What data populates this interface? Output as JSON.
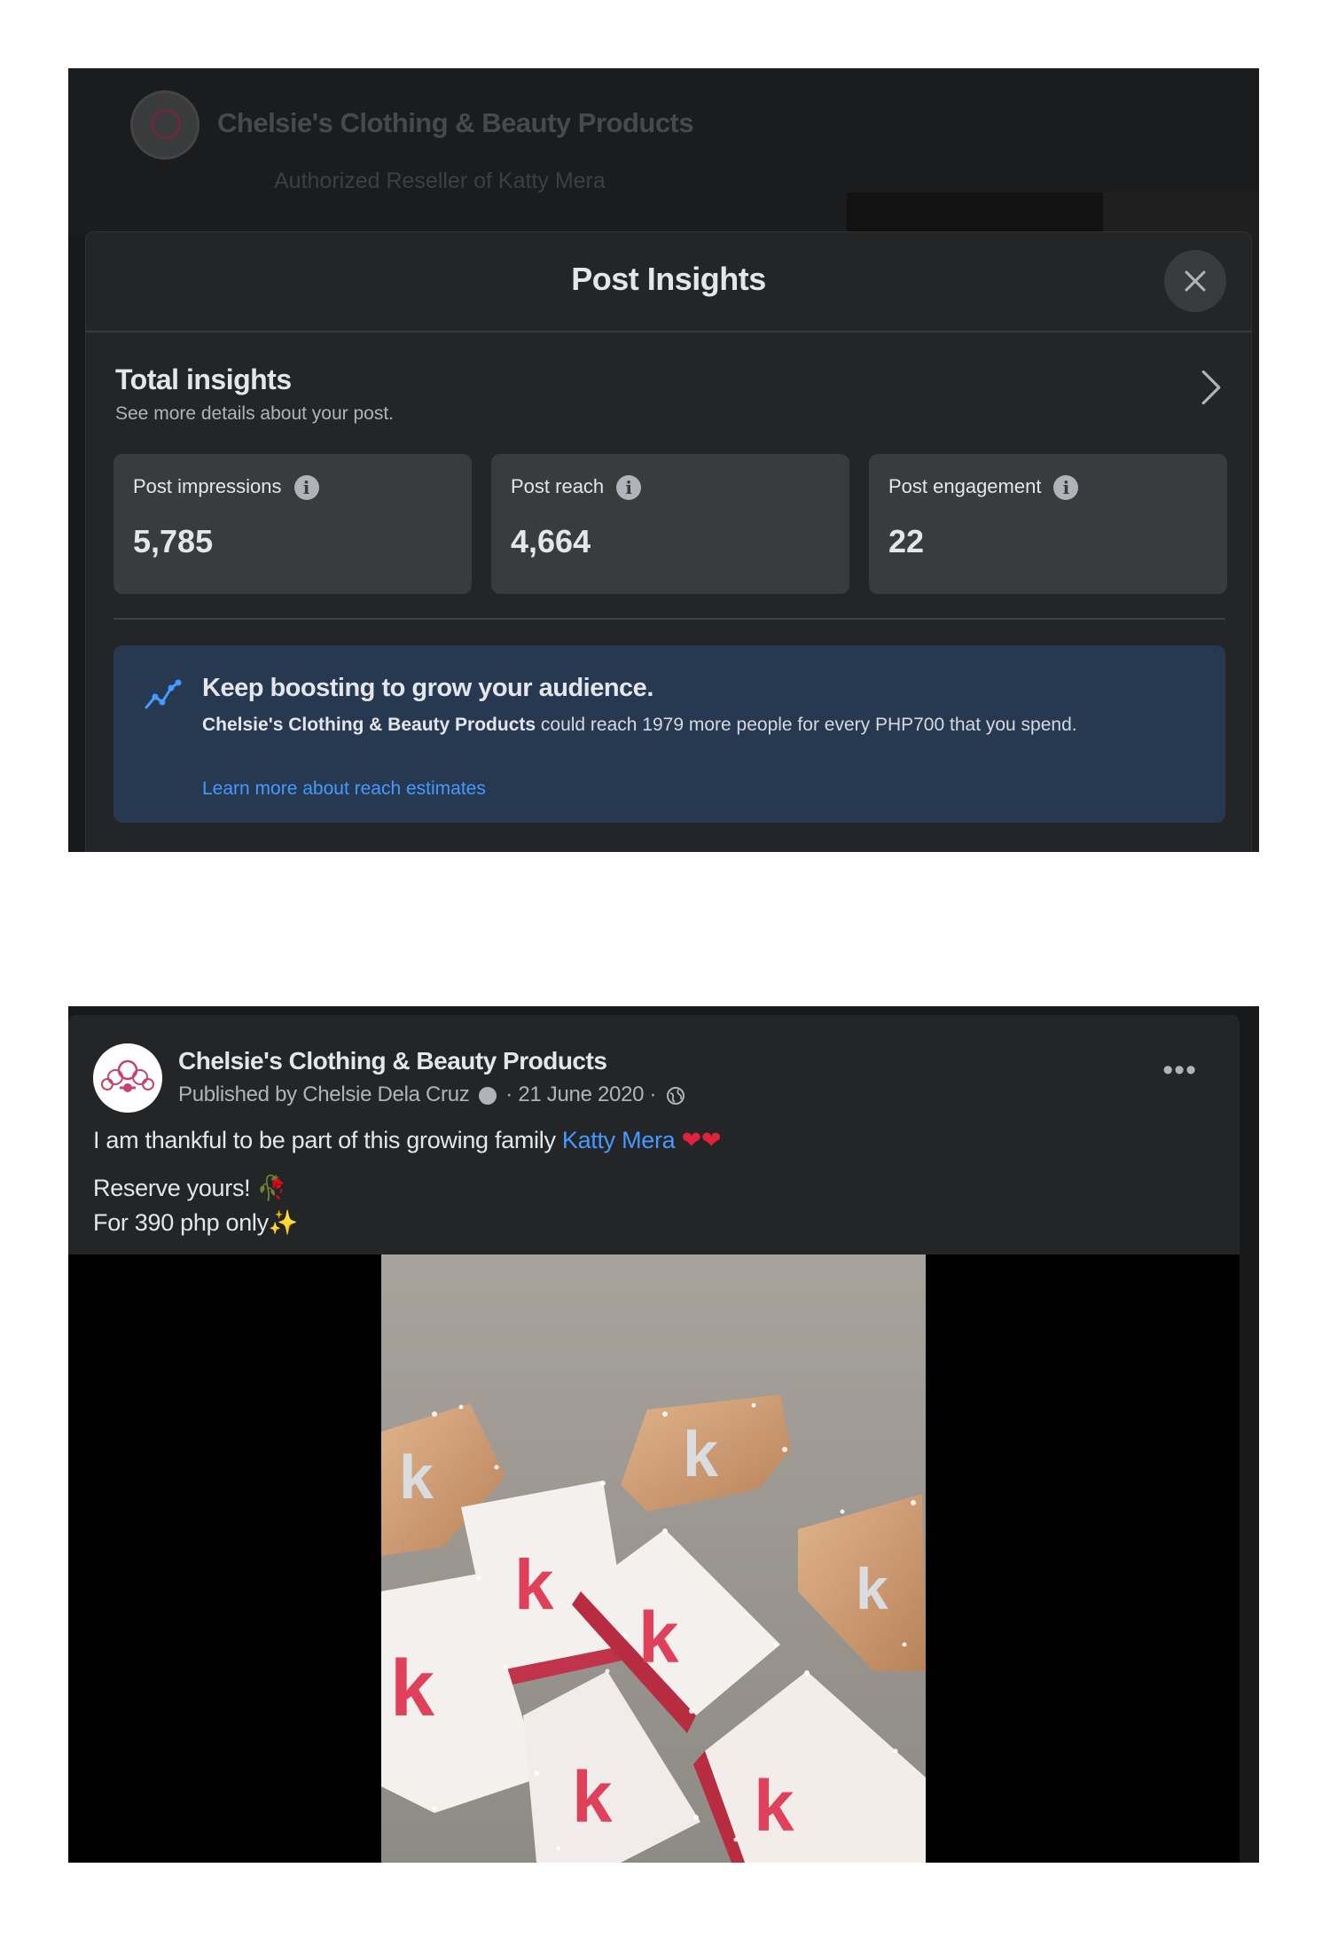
{
  "insights_screen": {
    "background_page": {
      "name": "Chelsie's Clothing & Beauty Products",
      "subtitle": "Authorized Reseller of Katty Mera"
    },
    "modal": {
      "title": "Post Insights",
      "close_icon": "close-icon",
      "total": {
        "title": "Total insights",
        "subtitle": "See more details about your post."
      },
      "metrics": [
        {
          "label": "Post impressions",
          "value": "5,785"
        },
        {
          "label": "Post reach",
          "value": "4,664"
        },
        {
          "label": "Post engagement",
          "value": "22"
        }
      ],
      "info_glyph": "i",
      "boost": {
        "title": "Keep boosting to grow your audience.",
        "page_name": "Chelsie's Clothing & Beauty Products",
        "body_rest": " could reach 1979 more people for every PHP700 that you spend.",
        "link": "Learn more about reach estimates"
      }
    }
  },
  "post_screen": {
    "page_name": "Chelsie's Clothing & Beauty Products",
    "meta_published": "Published by Chelsie Dela Cruz",
    "meta_date": "· 21 June 2020 ·",
    "more_label": "•••",
    "text_line1_before": "I am thankful to be part of this growing family ",
    "mention": "Katty Mera",
    "hearts": "❤❤",
    "text_line2": "Reserve yours! ",
    "flower": "🥀",
    "text_line3": "For 390 php only",
    "sparkle": "✨",
    "video_brand_letter": "k"
  },
  "colors": {
    "accent_blue": "#4599ff",
    "boost_bg": "#263951",
    "card_bg": "#3a3b3c",
    "modal_bg": "#242526",
    "brand_pink": "#e0405a"
  }
}
